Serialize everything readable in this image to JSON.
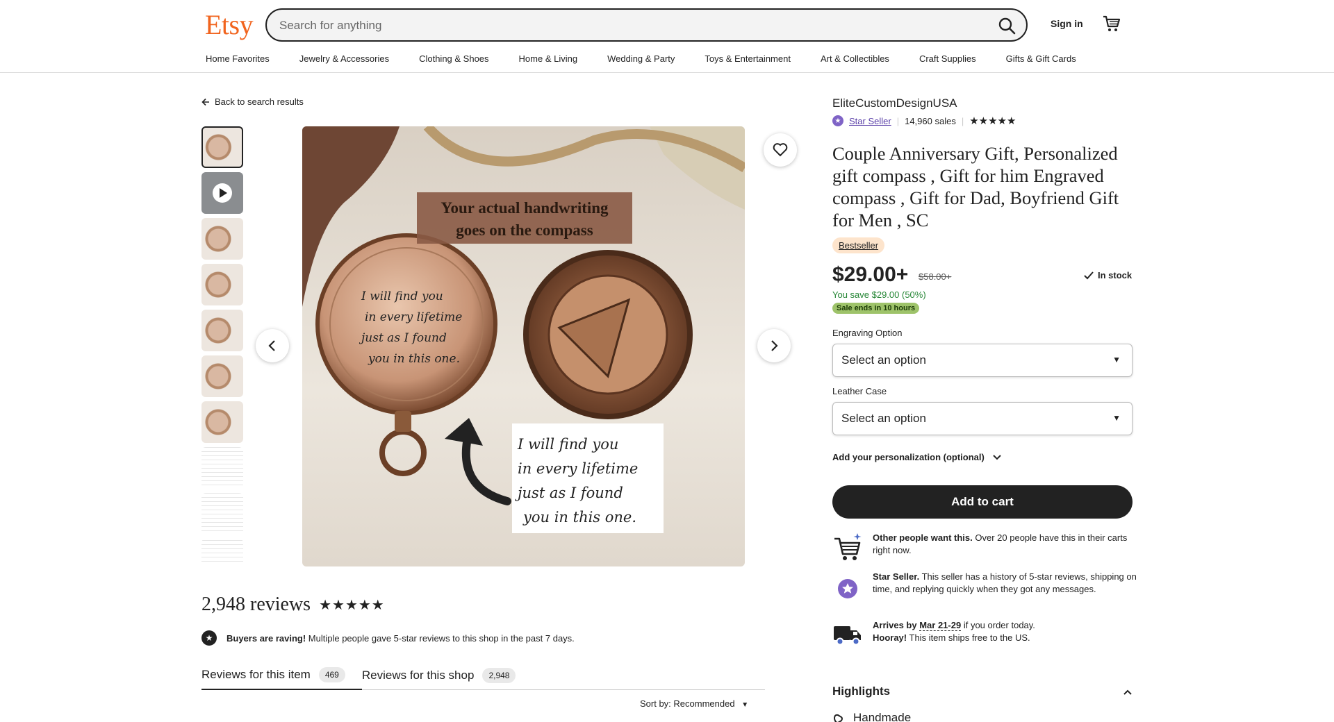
{
  "header": {
    "logo": "Etsy",
    "search_placeholder": "Search for anything",
    "signin": "Sign in",
    "categories": [
      "Home Favorites",
      "Jewelry & Accessories",
      "Clothing & Shoes",
      "Home & Living",
      "Wedding & Party",
      "Toys & Entertainment",
      "Art & Collectibles",
      "Craft Supplies",
      "Gifts & Gift Cards"
    ]
  },
  "gallery": {
    "back_label": "Back to search results",
    "image_caption": "Your actual handwriting goes on the compass",
    "handwriting": "I will find you in every lifetime just as I found you in this one."
  },
  "reviews": {
    "title": "2,948 reviews",
    "stars": "★★★★★",
    "raving_bold": "Buyers are raving!",
    "raving_text": "Multiple people gave 5-star reviews to this shop in the past 7 days.",
    "tab_item": "Reviews for this item",
    "tab_item_count": "469",
    "tab_shop": "Reviews for this shop",
    "tab_shop_count": "2,948",
    "sort": "Sort by: Recommended"
  },
  "listing": {
    "shop_name": "EliteCustomDesignUSA",
    "star_seller": "Star Seller",
    "sales": "14,960 sales",
    "rating_stars": "★★★★★",
    "title": "Couple Anniversary Gift, Personalized gift compass , Gift for him Engraved compass , Gift for Dad, Boyfriend Gift for Men , SC",
    "bestseller": "Bestseller",
    "price": "$29.00+",
    "old_price": "$58.00+",
    "in_stock": "In stock",
    "you_save": "You save $29.00 (50%)",
    "sale_ends": "Sale ends in 10 hours",
    "engraving_label": "Engraving Option",
    "engraving_value": "Select an option",
    "leather_label": "Leather Case",
    "leather_value": "Select an option",
    "personalization": "Add your personalization (optional)",
    "add_to_cart": "Add to cart",
    "perk1_bold": "Other people want this.",
    "perk1_text": "Over 20 people have this in their carts right now.",
    "perk2_bold": "Star Seller.",
    "perk2_text": "This seller has a history of 5-star reviews, shipping on time, and replying quickly when they got any messages.",
    "perk3_bold": "Arrives by",
    "perk3_date": "Mar 21-29",
    "perk3_text": "if you order today.",
    "perk3_bold2": "Hooray!",
    "perk3_text2": "This item ships free to the US.",
    "highlights": "Highlights",
    "handmade": "Handmade"
  },
  "colors": {
    "brand": "#F1641E",
    "star_seller": "#7F63C6",
    "save_green": "#258635",
    "sale_badge": "#9ec36a",
    "bestseller_badge": "#fde4cc"
  }
}
